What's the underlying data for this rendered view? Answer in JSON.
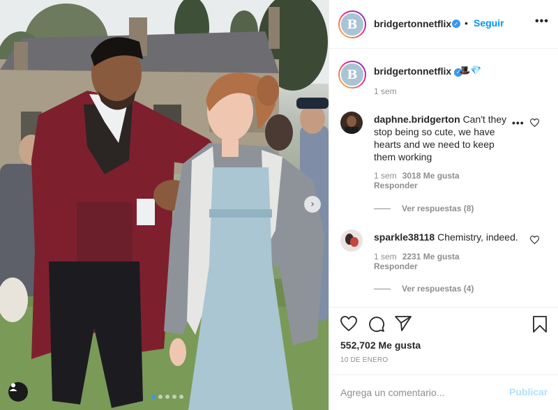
{
  "post": {
    "author": "bridgertonnetflix",
    "follow_label": "Seguir",
    "separator": "•",
    "avatar_letter": "B",
    "more_label": "•••"
  },
  "caption": {
    "author": "bridgertonnetflix",
    "emojis": "🎩💎",
    "time": "1 sem"
  },
  "comments": [
    {
      "author": "daphne.bridgerton",
      "text": "Can't they stop being so cute, we have hearts and we need to keep them working",
      "time": "1 sem",
      "likes": "3018 Me gusta",
      "reply_label": "Responder",
      "view_replies": "Ver respuestas (8)"
    },
    {
      "author": "sparkle38118",
      "text": "Chemistry, indeed.",
      "time": "1 sem",
      "likes": "2231 Me gusta",
      "reply_label": "Responder",
      "view_replies": "Ver respuestas (4)"
    }
  ],
  "actions": {
    "likes_count": "552,702 Me gusta",
    "date": "10 DE ENERO"
  },
  "composer": {
    "placeholder": "Agrega un comentario...",
    "submit_label": "Publicar"
  },
  "icons": {
    "verified": "verified-badge-icon",
    "like": "heart-icon",
    "comment": "comment-icon",
    "share": "paper-plane-icon",
    "save": "bookmark-icon",
    "next": "chevron-right-icon",
    "tag": "user-tag-icon"
  },
  "colors": {
    "accent": "#0095f6",
    "publish_disabled": "#b2dffc",
    "verified": "#3897f0",
    "muted": "#8e8e8e"
  }
}
